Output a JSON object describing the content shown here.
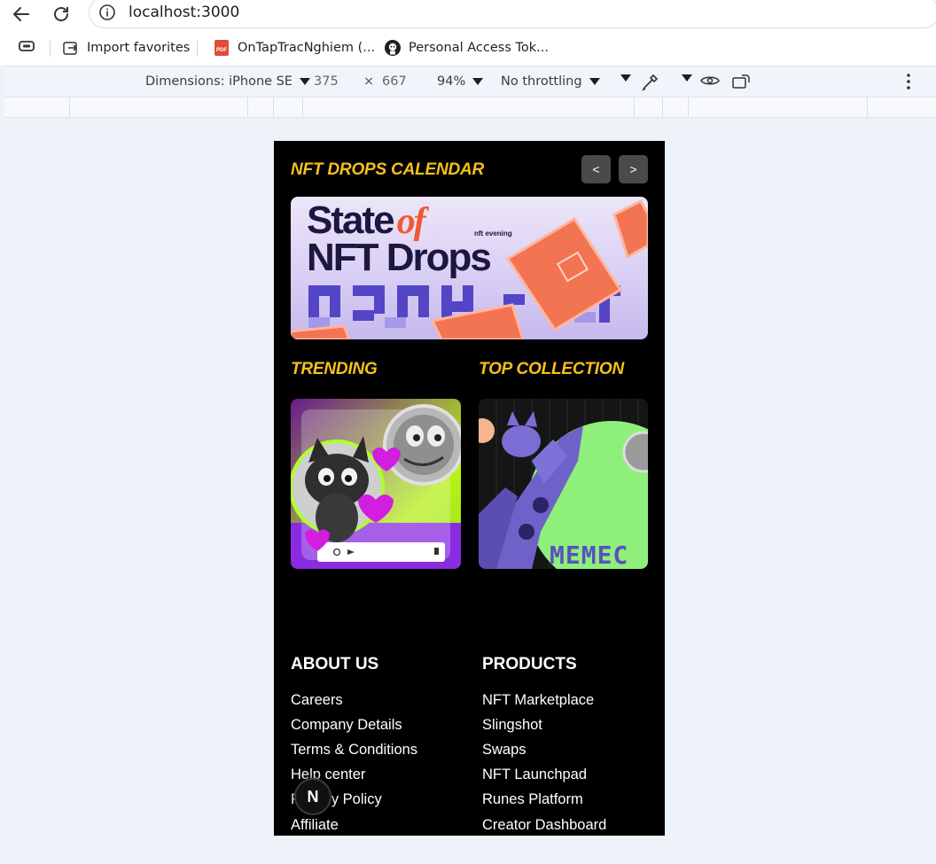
{
  "browser": {
    "url": "localhost:3000",
    "bookmarks": [
      {
        "label": "Import favorites",
        "icon": "import-icon"
      },
      {
        "label": "OnTapTracNghiem (...",
        "icon": "pdf-icon"
      },
      {
        "label": "Personal Access Tok...",
        "icon": "github-icon"
      }
    ]
  },
  "devtools": {
    "dimensions_label": "Dimensions: iPhone SE",
    "width": "375",
    "times": "×",
    "height": "667",
    "zoom": "94%",
    "throttling": "No throttling"
  },
  "page": {
    "calendar_title": "NFT DROPS CALENDAR",
    "prev_label": "<",
    "next_label": ">",
    "banner": {
      "line1a": "State",
      "line1b": "of",
      "logo": "nft evening",
      "line2": "NFT Drops",
      "pixel_text": "2024"
    },
    "trending_title": "TRENDING",
    "top_collection_title": "TOP COLLECTION",
    "top_collection_card_text": "MEMEC",
    "about": {
      "title": "ABOUT US",
      "links": [
        "Careers",
        "Company Details",
        "Terms & Conditions",
        "Help center",
        "Privacy Policy",
        "Affiliate"
      ]
    },
    "products": {
      "title": "PRODUCTS",
      "links": [
        "NFT Marketplace",
        "Slingshot",
        "Swaps",
        "NFT Launchpad",
        "Runes Platform",
        "Creator Dashboard"
      ]
    },
    "nextjs_badge": "N"
  },
  "colors": {
    "accent": "#f6c01a",
    "page_bg": "#000000",
    "button_bg": "#4a4a4a"
  }
}
